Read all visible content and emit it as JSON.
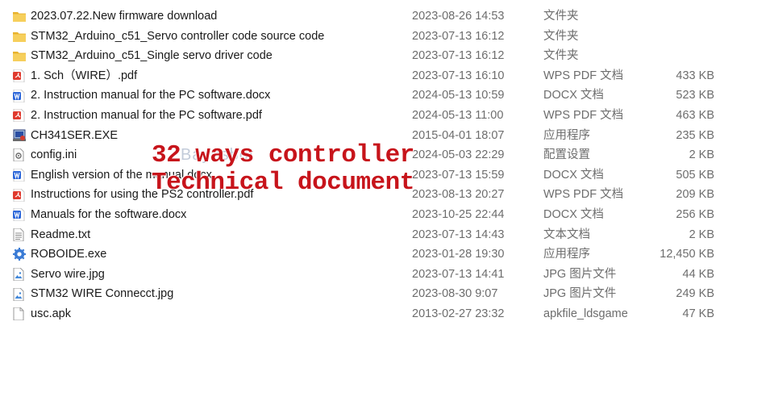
{
  "files": [
    {
      "name": "2023.07.22.New firmware download",
      "date": "2023-08-26 14:53",
      "type": "文件夹",
      "size": "",
      "icon": "folder-icon"
    },
    {
      "name": "STM32_Arduino_c51_Servo controller code source code",
      "date": "2023-07-13 16:12",
      "type": "文件夹",
      "size": "",
      "icon": "folder-icon"
    },
    {
      "name": "STM32_Arduino_c51_Single servo driver code",
      "date": "2023-07-13 16:12",
      "type": "文件夹",
      "size": "",
      "icon": "folder-icon"
    },
    {
      "name": "1. Sch（WIRE）.pdf",
      "date": "2023-07-13 16:10",
      "type": "WPS PDF 文档",
      "size": "433 KB",
      "icon": "pdf-icon"
    },
    {
      "name": "2. Instruction manual for the PC software.docx",
      "date": "2024-05-13 10:59",
      "type": "DOCX 文档",
      "size": "523 KB",
      "icon": "word-icon"
    },
    {
      "name": "2. Instruction manual for the PC software.pdf",
      "date": "2024-05-13 11:00",
      "type": "WPS PDF 文档",
      "size": "463 KB",
      "icon": "pdf-icon"
    },
    {
      "name": "CH341SER.EXE",
      "date": "2015-04-01 18:07",
      "type": "应用程序",
      "size": "235 KB",
      "icon": "installer-icon"
    },
    {
      "name": "config.ini",
      "date": "2024-05-03 22:29",
      "type": "配置设置",
      "size": "2 KB",
      "icon": "config-file-icon"
    },
    {
      "name": "English version of the manual.docx",
      "date": "2023-07-13 15:59",
      "type": "DOCX 文档",
      "size": "505 KB",
      "icon": "word-icon"
    },
    {
      "name": "Instructions for using the PS2 controller.pdf",
      "date": "2023-08-13 20:27",
      "type": "WPS PDF 文档",
      "size": "209 KB",
      "icon": "pdf-icon"
    },
    {
      "name": "Manuals for the software.docx",
      "date": "2023-10-25 22:44",
      "type": "DOCX 文档",
      "size": "256 KB",
      "icon": "word-icon"
    },
    {
      "name": "Readme.txt",
      "date": "2023-07-13 14:43",
      "type": "文本文档",
      "size": "2 KB",
      "icon": "text-file-icon"
    },
    {
      "name": "ROBOIDE.exe",
      "date": "2023-01-28 19:30",
      "type": "应用程序",
      "size": "12,450 KB",
      "icon": "app-gear-icon"
    },
    {
      "name": "Servo wire.jpg",
      "date": "2023-07-13 14:41",
      "type": "JPG 图片文件",
      "size": "44 KB",
      "icon": "image-file-icon"
    },
    {
      "name": "STM32 WIRE Connecct.jpg",
      "date": "2023-08-30 9:07",
      "type": "JPG 图片文件",
      "size": "249 KB",
      "icon": "image-file-icon"
    },
    {
      "name": "usc.apk",
      "date": "2013-02-27 23:32",
      "type": "apkfile_ldsgame",
      "size": "47 KB",
      "icon": "blank-file-icon"
    }
  ],
  "overlay": {
    "line1": "32 ways controller",
    "line2": "Technical document",
    "watermark": "Bayesbot"
  }
}
